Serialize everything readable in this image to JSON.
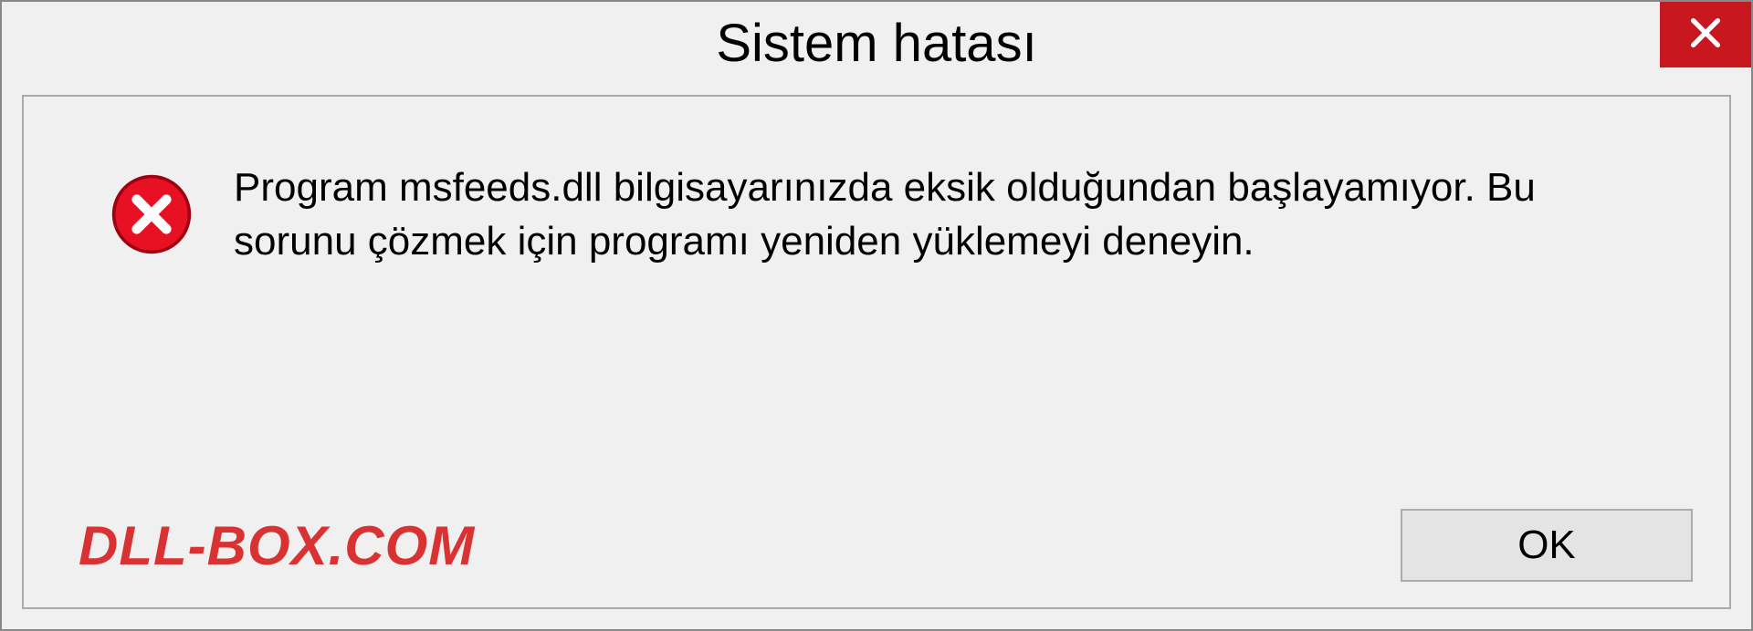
{
  "dialog": {
    "title": "Sistem hatası",
    "message": "Program msfeeds.dll bilgisayarınızda eksik olduğundan başlayamıyor. Bu sorunu çözmek için programı yeniden yüklemeyi deneyin.",
    "ok_label": "OK",
    "watermark": "DLL-BOX.COM"
  },
  "colors": {
    "close_bg": "#c8171e",
    "watermark": "#d93232",
    "error_icon": "#e81123"
  }
}
